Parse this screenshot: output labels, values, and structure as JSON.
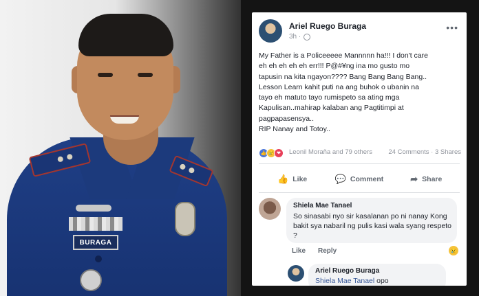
{
  "photo": {
    "nameplate": "BURAGA"
  },
  "post": {
    "author": "Ariel Ruego Buraga",
    "time": "3h ·",
    "body_lines": [
      "My Father is a Policeeeee Mannnnn ha!!! I don't care",
      "eh eh eh eh eh err!!! P@#¥ng ina mo gusto mo",
      "tapusin na kita ngayon???? Bang Bang Bang Bang..",
      "Lesson Learn kahit puti na ang buhok o ubanin na",
      "tayo eh matuto tayo rumispeto sa ating mga",
      "Kapulisan..mahirap kalaban ang Pagtitimpi at",
      "pagpapasensya..",
      "RIP Nanay and Totoy.."
    ],
    "reactions_text": "Leonil Moraña and 79 others",
    "counts_text": "24 Comments · 3 Shares",
    "actions": {
      "like": "Like",
      "comment": "Comment",
      "share": "Share"
    }
  },
  "comment": {
    "name": "Shiela Mae Tanael",
    "text": "So sinasabi nyo sir kasalanan po ni nanay Kong bakit sya nabaril ng pulis kasi wala syang respeto ?",
    "like": "Like",
    "reply": "Reply"
  },
  "reply": {
    "name": "Ariel Ruego Buraga",
    "mention": "Shiela Mae Tanael",
    "text": " opo"
  },
  "icons": {
    "like": "thumbs-up-icon",
    "comment": "speech-bubble-icon",
    "share": "share-arrow-icon",
    "more": "ellipsis-icon",
    "privacy": "globe-icon"
  },
  "colors": {
    "facebook_link": "#385898",
    "comment_bubble": "#f2f3f5",
    "uniform": "#1f3f86"
  }
}
